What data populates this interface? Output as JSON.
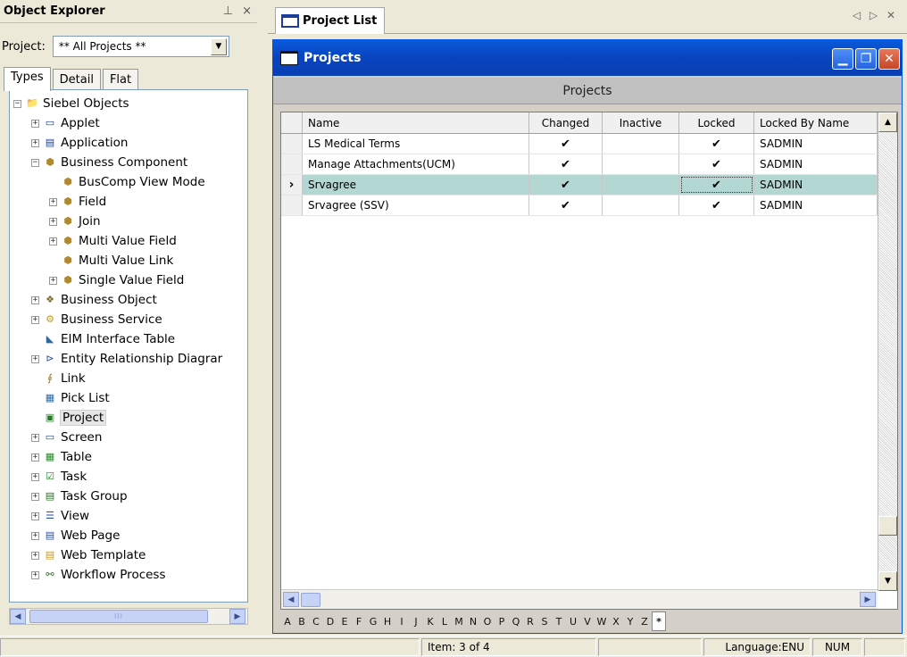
{
  "explorer": {
    "title": "Object Explorer",
    "pin_glyph": "⊥",
    "close_glyph": "×",
    "project_label": "Project:",
    "project_value": "** All Projects **",
    "tabs": [
      {
        "label": "Types",
        "active": true
      },
      {
        "label": "Detail",
        "active": false
      },
      {
        "label": "Flat",
        "active": false
      }
    ],
    "tree": [
      {
        "label": "Siebel Objects",
        "level": 0,
        "expander": "−",
        "icon": "folder-icon"
      },
      {
        "label": "Applet",
        "level": 1,
        "expander": "+",
        "icon": "applet-icon"
      },
      {
        "label": "Application",
        "level": 1,
        "expander": "+",
        "icon": "application-icon"
      },
      {
        "label": "Business Component",
        "level": 1,
        "expander": "−",
        "icon": "business-component-icon"
      },
      {
        "label": "BusComp View Mode",
        "level": 2,
        "expander": "",
        "icon": "business-component-icon"
      },
      {
        "label": "Field",
        "level": 2,
        "expander": "+",
        "icon": "business-component-icon"
      },
      {
        "label": "Join",
        "level": 2,
        "expander": "+",
        "icon": "business-component-icon"
      },
      {
        "label": "Multi Value Field",
        "level": 2,
        "expander": "+",
        "icon": "business-component-icon"
      },
      {
        "label": "Multi Value Link",
        "level": 2,
        "expander": "",
        "icon": "business-component-icon"
      },
      {
        "label": "Single Value Field",
        "level": 2,
        "expander": "+",
        "icon": "business-component-icon"
      },
      {
        "label": "Business Object",
        "level": 1,
        "expander": "+",
        "icon": "business-object-icon"
      },
      {
        "label": "Business Service",
        "level": 1,
        "expander": "+",
        "icon": "business-service-icon"
      },
      {
        "label": "EIM Interface Table",
        "level": 1,
        "expander": "",
        "icon": "eim-table-icon"
      },
      {
        "label": "Entity Relationship Diagrar",
        "level": 1,
        "expander": "+",
        "icon": "erd-icon"
      },
      {
        "label": "Link",
        "level": 1,
        "expander": "",
        "icon": "link-icon"
      },
      {
        "label": "Pick List",
        "level": 1,
        "expander": "",
        "icon": "pick-list-icon"
      },
      {
        "label": "Project",
        "level": 1,
        "expander": "",
        "icon": "project-icon",
        "selected": true
      },
      {
        "label": "Screen",
        "level": 1,
        "expander": "+",
        "icon": "screen-icon"
      },
      {
        "label": "Table",
        "level": 1,
        "expander": "+",
        "icon": "table-icon"
      },
      {
        "label": "Task",
        "level": 1,
        "expander": "+",
        "icon": "task-icon"
      },
      {
        "label": "Task Group",
        "level": 1,
        "expander": "+",
        "icon": "task-group-icon"
      },
      {
        "label": "View",
        "level": 1,
        "expander": "+",
        "icon": "view-icon"
      },
      {
        "label": "Web Page",
        "level": 1,
        "expander": "+",
        "icon": "web-page-icon"
      },
      {
        "label": "Web Template",
        "level": 1,
        "expander": "+",
        "icon": "web-template-icon"
      },
      {
        "label": "Workflow Process",
        "level": 1,
        "expander": "+",
        "icon": "workflow-icon"
      }
    ]
  },
  "doc_tab": {
    "label": "Project List",
    "nav_glyphs": "◁ ▷ ✕"
  },
  "window": {
    "title": "Projects",
    "applet_header": "Projects",
    "btn_minimize": "▁",
    "btn_restore": "❐",
    "btn_close": "✕"
  },
  "grid": {
    "columns": [
      "Name",
      "Changed",
      "Inactive",
      "Locked",
      "Locked By Name"
    ],
    "check_glyph": "✔",
    "selector_glyph": "›",
    "rows": [
      {
        "name": "LS Medical Terms",
        "changed": true,
        "inactive": false,
        "locked": true,
        "locked_by": "SADMIN",
        "selected": false
      },
      {
        "name": "Manage Attachments(UCM)",
        "changed": true,
        "inactive": false,
        "locked": true,
        "locked_by": "SADMIN",
        "selected": false
      },
      {
        "name": "Srvagree",
        "changed": true,
        "inactive": false,
        "locked": true,
        "locked_by": "SADMIN",
        "selected": true
      },
      {
        "name": "Srvagree (SSV)",
        "changed": true,
        "inactive": false,
        "locked": true,
        "locked_by": "SADMIN",
        "selected": false
      }
    ]
  },
  "alphabet": [
    "A",
    "B",
    "C",
    "D",
    "E",
    "F",
    "G",
    "H",
    "I",
    "J",
    "K",
    "L",
    "M",
    "N",
    "O",
    "P",
    "Q",
    "R",
    "S",
    "T",
    "U",
    "V",
    "W",
    "X",
    "Y",
    "Z",
    "*"
  ],
  "alphabet_active": "*",
  "status": {
    "item": "Item:  3 of 4",
    "language": "Language:ENU",
    "num": "NUM"
  }
}
